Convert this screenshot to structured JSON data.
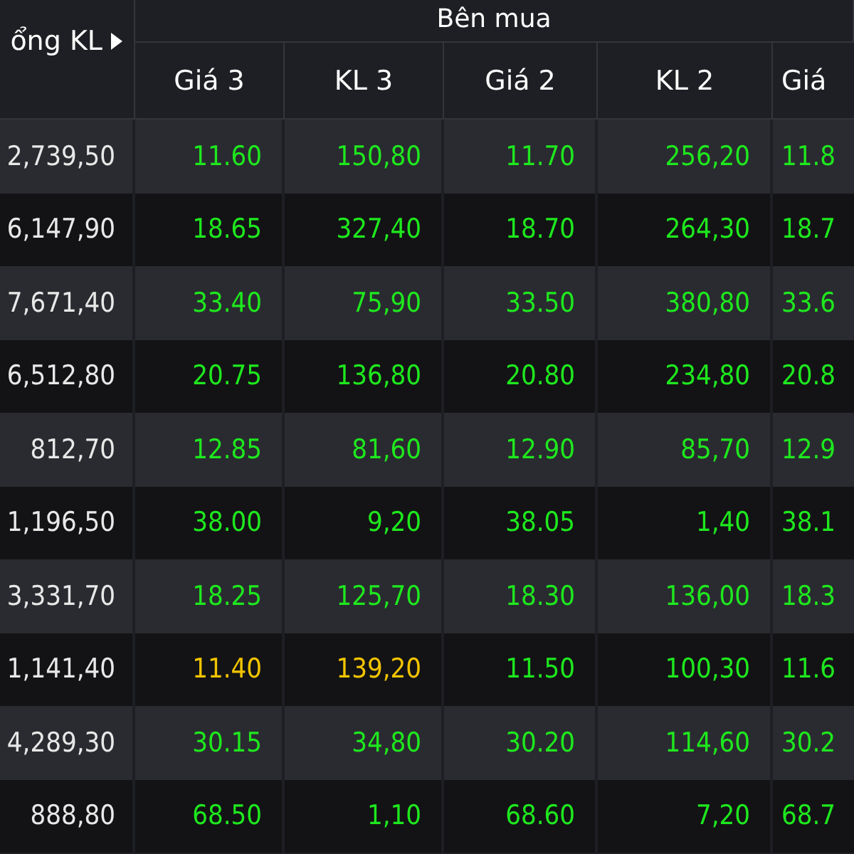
{
  "header": {
    "total_label": "ổng KL",
    "group_label": "Bên mua",
    "columns": [
      "Giá 3",
      "KL 3",
      "Giá 2",
      "KL 2",
      "Giá"
    ]
  },
  "rows": [
    {
      "total": "2,739,50",
      "cells": [
        {
          "text": "11.60",
          "kind": "up"
        },
        {
          "text": "150,80",
          "kind": "up"
        },
        {
          "text": "11.70",
          "kind": "up"
        },
        {
          "text": "256,20",
          "kind": "up"
        },
        {
          "text": "11.8",
          "kind": "up"
        }
      ]
    },
    {
      "total": "6,147,90",
      "cells": [
        {
          "text": "18.65",
          "kind": "up"
        },
        {
          "text": "327,40",
          "kind": "up"
        },
        {
          "text": "18.70",
          "kind": "up"
        },
        {
          "text": "264,30",
          "kind": "up"
        },
        {
          "text": "18.7",
          "kind": "up"
        }
      ]
    },
    {
      "total": "7,671,40",
      "cells": [
        {
          "text": "33.40",
          "kind": "up"
        },
        {
          "text": "75,90",
          "kind": "up"
        },
        {
          "text": "33.50",
          "kind": "up"
        },
        {
          "text": "380,80",
          "kind": "up"
        },
        {
          "text": "33.6",
          "kind": "up"
        }
      ]
    },
    {
      "total": "6,512,80",
      "cells": [
        {
          "text": "20.75",
          "kind": "up"
        },
        {
          "text": "136,80",
          "kind": "up"
        },
        {
          "text": "20.80",
          "kind": "up"
        },
        {
          "text": "234,80",
          "kind": "up"
        },
        {
          "text": "20.8",
          "kind": "up"
        }
      ]
    },
    {
      "total": "812,70",
      "cells": [
        {
          "text": "12.85",
          "kind": "up"
        },
        {
          "text": "81,60",
          "kind": "up"
        },
        {
          "text": "12.90",
          "kind": "up"
        },
        {
          "text": "85,70",
          "kind": "up"
        },
        {
          "text": "12.9",
          "kind": "up"
        }
      ]
    },
    {
      "total": "1,196,50",
      "cells": [
        {
          "text": "38.00",
          "kind": "up"
        },
        {
          "text": "9,20",
          "kind": "up"
        },
        {
          "text": "38.05",
          "kind": "up"
        },
        {
          "text": "1,40",
          "kind": "up"
        },
        {
          "text": "38.1",
          "kind": "up"
        }
      ]
    },
    {
      "total": "3,331,70",
      "cells": [
        {
          "text": "18.25",
          "kind": "up"
        },
        {
          "text": "125,70",
          "kind": "up"
        },
        {
          "text": "18.30",
          "kind": "up"
        },
        {
          "text": "136,00",
          "kind": "up"
        },
        {
          "text": "18.3",
          "kind": "up"
        }
      ]
    },
    {
      "total": "1,141,40",
      "cells": [
        {
          "text": "11.40",
          "kind": "ref"
        },
        {
          "text": "139,20",
          "kind": "ref"
        },
        {
          "text": "11.50",
          "kind": "up"
        },
        {
          "text": "100,30",
          "kind": "up"
        },
        {
          "text": "11.6",
          "kind": "up"
        }
      ]
    },
    {
      "total": "4,289,30",
      "cells": [
        {
          "text": "30.15",
          "kind": "up"
        },
        {
          "text": "34,80",
          "kind": "up"
        },
        {
          "text": "30.20",
          "kind": "up"
        },
        {
          "text": "114,60",
          "kind": "up"
        },
        {
          "text": "30.2",
          "kind": "up"
        }
      ]
    },
    {
      "total": "888,80",
      "cells": [
        {
          "text": "68.50",
          "kind": "up"
        },
        {
          "text": "1,10",
          "kind": "up"
        },
        {
          "text": "68.60",
          "kind": "up"
        },
        {
          "text": "7,20",
          "kind": "up"
        },
        {
          "text": "68.7",
          "kind": "up"
        }
      ]
    }
  ]
}
